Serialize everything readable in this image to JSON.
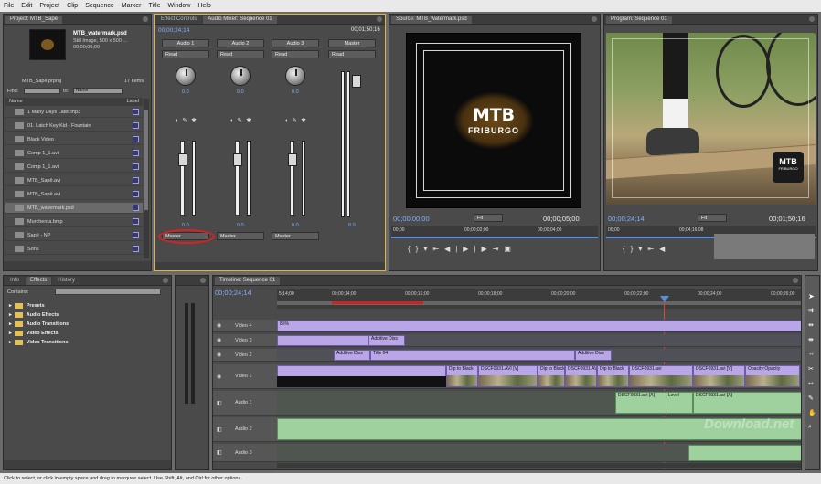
{
  "menu": [
    "File",
    "Edit",
    "Project",
    "Clip",
    "Sequence",
    "Marker",
    "Title",
    "Window",
    "Help"
  ],
  "project": {
    "tab": "Project: MTB_Sapê",
    "clip_name": "MTB_watermark.psd",
    "clip_info": "Still Image, 500 x 500 ...",
    "clip_duration": "00;00;05;00",
    "project_file": "MTB_Sapê.prproj",
    "item_count": "17 Items",
    "find_label": "Find:",
    "in_label": "In:",
    "in_value": "Name",
    "col_name": "Name",
    "col_label": "Label",
    "items": [
      "1 Many Days Later.mp3",
      "01. Latch Key Kid - Fountain",
      "Black Video",
      "Comp 1_1.avi",
      "Comp 1_1.avi",
      "MTB_Sapê.avi",
      "MTB_Sapê.avi",
      "MTB_watermark.psd",
      "Murcherda.bmp",
      "Sapê - NP",
      "Sons"
    ]
  },
  "mixer": {
    "tab1": "Effect Controls",
    "tab2": "Audio Mixer: Sequence 01",
    "tc_left": "00;00;24;14",
    "tc_right": "00;01;50;16",
    "channels": [
      "Audio 1",
      "Audio 2",
      "Audio 3",
      "Master"
    ],
    "modes": [
      "Read",
      "Read",
      "Read",
      "Read"
    ],
    "vals": [
      "0.0",
      "0.0",
      "0.0"
    ],
    "bottom_vals": [
      "0.0",
      "0.0",
      "0.0",
      "0.0"
    ],
    "sends": [
      "Master",
      "Master",
      "Master"
    ]
  },
  "source": {
    "tab": "Source: MTB_watermark.psd",
    "logo_line1": "MTB",
    "logo_line2": "FRIBURGO",
    "tc_left": "00;00;00;00",
    "fit": "Fit",
    "tc_right": "00;00;05;00",
    "ruler_left": "00;00",
    "ruler_mid": "00;00;02;00",
    "ruler_right": "00;00;04;00"
  },
  "program": {
    "tab": "Program: Sequence 01",
    "tc_left": "00;00;24;14",
    "fit": "Fit",
    "tc_right": "00;01;50;16",
    "ruler_left": "00;00",
    "ruler_mid": "00;04;16;08",
    "wm1": "MTB",
    "wm2": "FRIBURGO"
  },
  "effects": {
    "tabs": [
      "Info",
      "Effects",
      "History"
    ],
    "contains_label": "Contains:",
    "folders": [
      "Presets",
      "Audio Effects",
      "Audio Transitions",
      "Video Effects",
      "Video Transitions"
    ]
  },
  "timeline": {
    "tab": "Timeline: Sequence 01",
    "timecode": "00;00;24;14",
    "ruler": [
      "00;00;14;00",
      "00;00;16;00",
      "00;00;18;00",
      "00;00;20;00",
      "00;00;22;00",
      "00;00;24;00",
      "00;00;26;00"
    ],
    "ruler_left": "5;14;00",
    "tracks": [
      "Video 4",
      "Video 3",
      "Video 2",
      "Video 1",
      "Audio 1",
      "Audio 2",
      "Audio 3"
    ],
    "clips": {
      "v4": "85%",
      "v3": "Additive Diss",
      "v2a": "Additive Diss",
      "v2b": "Title 04",
      "v2c": "Additive Diss",
      "v1": [
        "Dip to Black",
        "DSCF0931.AVI [V]",
        "Dip to Black",
        "DSCF0931.AVI",
        "Dip to Black",
        "DSCF0931.avi",
        "DSCF0931.avi [V]",
        "Opacity:Opacity"
      ],
      "a1": "DSCF0931.avi [A]",
      "a1b": "Level",
      "a1c": "DSCF0931.avi [A]"
    }
  },
  "status": "Click to select, or click in empty space and drag to marquee select. Use Shift, Alt, and Ctrl for other options.",
  "watermark": "Download.net"
}
